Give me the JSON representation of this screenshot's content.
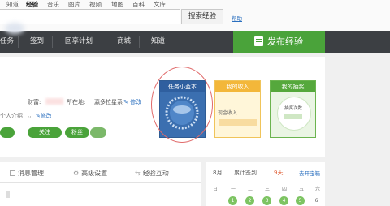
{
  "top_nav": {
    "links": [
      "知道",
      "经验",
      "音乐",
      "图片",
      "视频",
      "地图",
      "百科",
      "文库"
    ],
    "active": "经验"
  },
  "search": {
    "button_label": "搜索经验",
    "help_label": "帮助"
  },
  "main_nav": {
    "items": [
      "任务",
      "签到",
      "回享计划",
      "商城",
      "知道"
    ],
    "publish_label": "发布经验"
  },
  "profile": {
    "wealth_label": "财富:",
    "location_label": "所在地:",
    "location_value": "瀛多拉星系",
    "edit_label": "修改",
    "intro_label": "个人介绍",
    "intro_edit": "修改",
    "follow_label": "关注",
    "fans_label": "粉丝"
  },
  "cards": {
    "task_title": "任务小蓝本",
    "income_title": "我的收入",
    "income_sub": "现金收入",
    "lottery_title": "我的抽奖",
    "lottery_sub": "抽奖次数"
  },
  "tabs": [
    "消息管理",
    "高级设置",
    "经验互动"
  ],
  "calendar": {
    "month": "8月",
    "signin_label": "累计签到",
    "signin_days": "9天",
    "remind_label": "去开宝箱",
    "weekdays": [
      "日",
      "一",
      "二",
      "三",
      "四",
      "五",
      "六"
    ],
    "days": [
      "1",
      "2",
      "3",
      "4",
      "5",
      "6"
    ]
  },
  "colors": {
    "nav_bg": "#3c3f43",
    "publish_green": "#4aa33a",
    "link_blue": "#2a6fbf",
    "annotation_red": "#e06a6a"
  }
}
